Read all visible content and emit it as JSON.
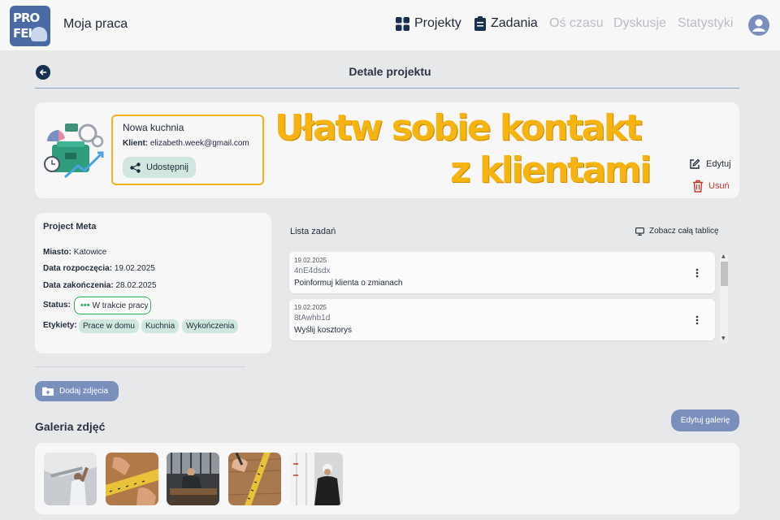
{
  "app": {
    "logo_top": "PRO",
    "logo_bottom": "FELI",
    "title": "Moja praca"
  },
  "nav": [
    {
      "label": "Projekty",
      "icon": "grid-icon",
      "active": true
    },
    {
      "label": "Zadania",
      "icon": "clipboard-icon",
      "active": true
    },
    {
      "label": "Oś czasu",
      "active": false
    },
    {
      "label": "Dyskusje",
      "active": false
    },
    {
      "label": "Statystyki",
      "active": false
    }
  ],
  "page": {
    "title": "Detale projektu"
  },
  "project": {
    "name": "Nowa kuchnia",
    "client_label": "Klient:",
    "client_email": "elizabeth.week@gmail.com",
    "share_label": "Udostępnij",
    "edit_label": "Edytuj",
    "delete_label": "Usuń"
  },
  "promo": {
    "line1": "Ułatw sobie kontakt",
    "line2": "z klientami",
    "color": "#f6b412"
  },
  "meta": {
    "title": "Project Meta",
    "city_label": "Miasto:",
    "city": "Katowice",
    "start_label": "Data rozpoczęcia:",
    "start": "19.02.2025",
    "end_label": "Data zakończenia:",
    "end": "28.02.2025",
    "status_label": "Status:",
    "status": "W trakcie pracy",
    "status_color": "#2fae5c",
    "tags_label": "Etykiety:",
    "tags": [
      "Prace w domu",
      "Kuchnia",
      "Wykończenia"
    ]
  },
  "tasks": {
    "title": "Lista zadań",
    "board_link": "Zobacz całą tablicę",
    "items": [
      {
        "date": "19.02.2025",
        "code": "4nE4dsdx",
        "desc": "Poinformuj klienta o zmianach"
      },
      {
        "date": "19.02.2025",
        "code": "8tAwhb1d",
        "desc": "Wyślij kosztorys"
      }
    ]
  },
  "gallery": {
    "add_label": "Dodaj zdjęcia",
    "title": "Galeria zdjęć",
    "edit_label": "Edytuj galerię",
    "photos": [
      "photo-ceiling-worker",
      "photo-measuring-tape",
      "photo-workshop",
      "photo-tape-on-wood",
      "photo-window-installer"
    ]
  },
  "colors": {
    "accent": "#7b8fbd",
    "tag_bg": "#cfe7df",
    "danger": "#c0392b",
    "highlight_border": "#f2b21b"
  }
}
